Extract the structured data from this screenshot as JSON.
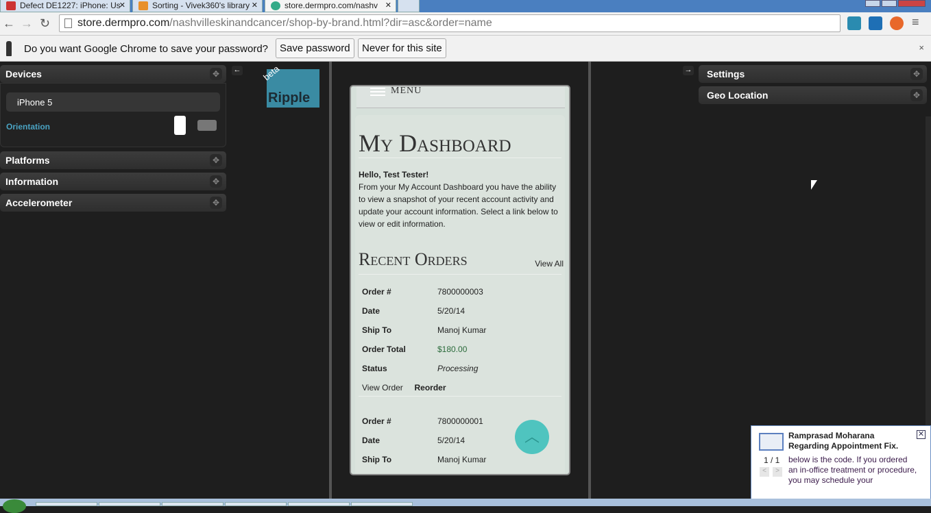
{
  "browser": {
    "tabs": [
      {
        "label": "Defect DE1227: iPhone: Us"
      },
      {
        "label": "Sorting - Vivek360's library"
      },
      {
        "label": "store.dermpro.com/nashv"
      }
    ],
    "url_host": "store.dermpro.com",
    "url_path": "/nashvilleskinandcancer/shop-by-brand.html?dir=asc&order=name",
    "infobar": {
      "message": "Do you want Google Chrome to save your password?",
      "save_label": "Save password",
      "never_label": "Never for this site",
      "close": "×"
    }
  },
  "left_panel": {
    "devices_title": "Devices",
    "device": "iPhone 5",
    "orientation_label": "Orientation",
    "panels": [
      {
        "label": "Platforms"
      },
      {
        "label": "Information"
      },
      {
        "label": "Accelerometer"
      }
    ]
  },
  "logo": {
    "text": "Ripple",
    "badge": "beta"
  },
  "right_panel": {
    "panels": [
      {
        "label": "Settings"
      },
      {
        "label": "Geo Location"
      }
    ]
  },
  "phone": {
    "menu": "MENU",
    "title": "My Dashboard",
    "greeting": "Hello, Test Tester!",
    "intro": "From your My Account Dashboard you have the ability to view a snapshot of your recent account activity and update your account information. Select a link below to view or edit information.",
    "recent_orders": "Recent Orders",
    "view_all": "View All",
    "labels": {
      "order": "Order #",
      "date": "Date",
      "ship_to": "Ship To",
      "total": "Order Total",
      "status": "Status"
    },
    "orders": [
      {
        "number": "7800000003",
        "date": "5/20/14",
        "ship_to": "Manoj Kumar",
        "total": "$180.00",
        "status": "Processing",
        "view": "View Order",
        "reorder": "Reorder"
      },
      {
        "number": "7800000001",
        "date": "5/20/14",
        "ship_to": "Manoj Kumar"
      }
    ]
  },
  "notification": {
    "sender": "Ramprasad Moharana",
    "subject": "Regarding Appointment Fix.",
    "count": "1 / 1",
    "body": "below is the code. If you ordered an in-office treatment or procedure, you may schedule your"
  }
}
